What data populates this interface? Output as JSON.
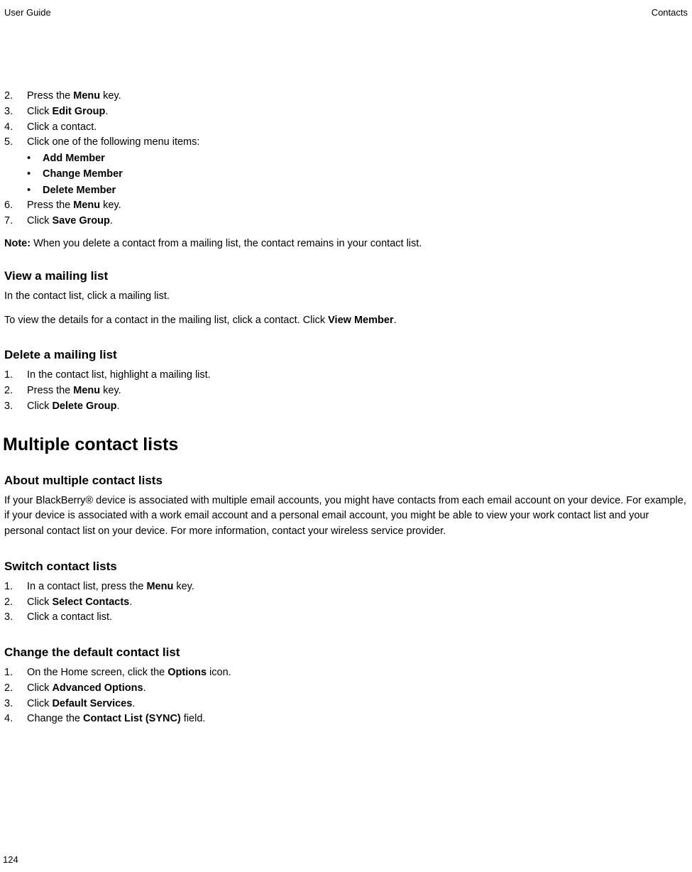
{
  "header": {
    "left": "User Guide",
    "right": "Contacts"
  },
  "steps1": {
    "s2": {
      "num": "2.",
      "pre": "Press the ",
      "bold": "Menu",
      "post": " key."
    },
    "s3": {
      "num": "3.",
      "pre": "Click ",
      "bold": "Edit Group",
      "post": "."
    },
    "s4": {
      "num": "4.",
      "text": "Click a contact."
    },
    "s5": {
      "num": "5.",
      "text": "Click one of the following menu items:"
    },
    "bullets": {
      "b1": "Add Member",
      "b2": "Change Member",
      "b3": "Delete Member"
    },
    "s6": {
      "num": "6.",
      "pre": "Press the ",
      "bold": "Menu",
      "post": " key."
    },
    "s7": {
      "num": "7.",
      "pre": "Click ",
      "bold": "Save Group",
      "post": "."
    }
  },
  "note": {
    "label": "Note:",
    "text": "  When you delete a contact from a mailing list, the contact remains in your contact list."
  },
  "view": {
    "heading": "View a mailing list",
    "p1": "In the contact list, click a mailing list.",
    "p2_pre": "To view the details for a contact in the mailing list, click a contact. Click ",
    "p2_bold": "View Member",
    "p2_post": "."
  },
  "delete": {
    "heading": "Delete a mailing list",
    "s1": {
      "num": "1.",
      "text": "In the contact list, highlight a mailing list."
    },
    "s2": {
      "num": "2.",
      "pre": "Press the ",
      "bold": "Menu",
      "post": " key."
    },
    "s3": {
      "num": "3.",
      "pre": "Click ",
      "bold": "Delete Group",
      "post": "."
    }
  },
  "h2": "Multiple contact lists",
  "about": {
    "heading": "About multiple contact lists",
    "p1": "If your BlackBerry® device is associated with multiple email accounts, you might have contacts from each email account on your device. For example, if your device is associated with a work email account and a personal email account, you might be able to view your work contact list and your personal contact list on your device. For more information, contact your wireless service provider."
  },
  "switch": {
    "heading": "Switch contact lists",
    "s1": {
      "num": "1.",
      "pre": "In a contact list, press the ",
      "bold": "Menu",
      "post": " key."
    },
    "s2": {
      "num": "2.",
      "pre": "Click ",
      "bold": "Select Contacts",
      "post": "."
    },
    "s3": {
      "num": "3.",
      "text": "Click a contact list."
    }
  },
  "change": {
    "heading": "Change the default contact list",
    "s1": {
      "num": "1.",
      "pre": "On the Home screen, click the ",
      "bold": "Options",
      "post": " icon."
    },
    "s2": {
      "num": "2.",
      "pre": "Click ",
      "bold": "Advanced Options",
      "post": "."
    },
    "s3": {
      "num": "3.",
      "pre": "Click ",
      "bold": "Default Services",
      "post": "."
    },
    "s4": {
      "num": "4.",
      "pre": "Change the ",
      "bold": "Contact List (SYNC)",
      "post": " field."
    }
  },
  "pageNumber": "124"
}
